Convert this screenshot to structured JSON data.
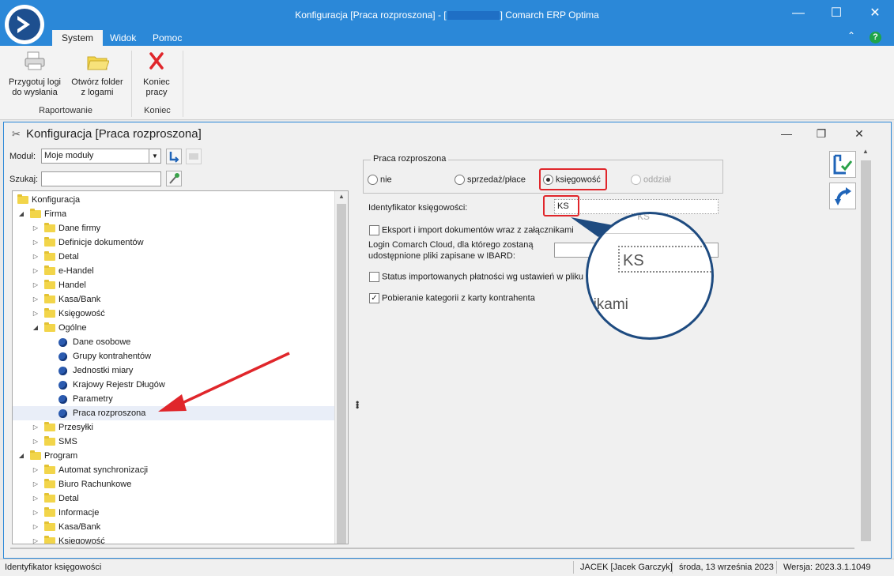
{
  "window": {
    "title_prefix": "Konfiguracja [Praca rozproszona] - [",
    "title_suffix": "] Comarch ERP Optima",
    "minimize": "—",
    "maximize": "☐",
    "close": "✕"
  },
  "menu": {
    "tabs": [
      "System",
      "Widok",
      "Pomoc"
    ],
    "active": "System",
    "collapse": "⌃",
    "help": "?"
  },
  "ribbon": {
    "buttons": [
      {
        "line1": "Przygotuj logi",
        "line2": "do wysłania",
        "icon": "printer-icon"
      },
      {
        "line1": "Otwórz folder",
        "line2": "z logami",
        "icon": "folder-icon"
      },
      {
        "line1": "Koniec",
        "line2": "pracy",
        "icon": "close-x-icon"
      }
    ],
    "groups": [
      "Raportowanie",
      "Koniec"
    ]
  },
  "inner_window": {
    "title": "Konfiguracja [Praca rozproszona]",
    "minimize": "—",
    "restore": "❐",
    "close": "✕"
  },
  "filter": {
    "module_label": "Moduł:",
    "module_value": "Moje moduły",
    "search_label": "Szukaj:",
    "search_value": ""
  },
  "tree": {
    "items": [
      {
        "label": "Konfiguracja",
        "level": 0,
        "type": "root",
        "expand": ""
      },
      {
        "label": "Firma",
        "level": 1,
        "type": "folder",
        "expand": "◢"
      },
      {
        "label": "Dane firmy",
        "level": 2,
        "type": "folder",
        "expand": "▷"
      },
      {
        "label": "Definicje dokumentów",
        "level": 2,
        "type": "folder",
        "expand": "▷"
      },
      {
        "label": "Detal",
        "level": 2,
        "type": "folder",
        "expand": "▷"
      },
      {
        "label": "e-Handel",
        "level": 2,
        "type": "folder",
        "expand": "▷"
      },
      {
        "label": "Handel",
        "level": 2,
        "type": "folder",
        "expand": "▷"
      },
      {
        "label": "Kasa/Bank",
        "level": 2,
        "type": "folder",
        "expand": "▷"
      },
      {
        "label": "Księgowość",
        "level": 2,
        "type": "folder",
        "expand": "▷"
      },
      {
        "label": "Ogólne",
        "level": 2,
        "type": "folder",
        "expand": "◢"
      },
      {
        "label": "Dane osobowe",
        "level": 3,
        "type": "leaf",
        "expand": ""
      },
      {
        "label": "Grupy kontrahentów",
        "level": 3,
        "type": "leaf",
        "expand": ""
      },
      {
        "label": "Jednostki miary",
        "level": 3,
        "type": "leaf",
        "expand": ""
      },
      {
        "label": "Krajowy Rejestr Długów",
        "level": 3,
        "type": "leaf",
        "expand": ""
      },
      {
        "label": "Parametry",
        "level": 3,
        "type": "leaf",
        "expand": ""
      },
      {
        "label": "Praca rozproszona",
        "level": 3,
        "type": "leaf",
        "expand": "",
        "selected": true
      },
      {
        "label": "Przesyłki",
        "level": 2,
        "type": "folder",
        "expand": "▷"
      },
      {
        "label": "SMS",
        "level": 2,
        "type": "folder",
        "expand": "▷"
      },
      {
        "label": "Program",
        "level": 1,
        "type": "folder",
        "expand": "◢"
      },
      {
        "label": "Automat synchronizacji",
        "level": 2,
        "type": "folder",
        "expand": "▷"
      },
      {
        "label": "Biuro Rachunkowe",
        "level": 2,
        "type": "folder",
        "expand": "▷"
      },
      {
        "label": "Detal",
        "level": 2,
        "type": "folder",
        "expand": "▷"
      },
      {
        "label": "Informacje",
        "level": 2,
        "type": "folder",
        "expand": "▷"
      },
      {
        "label": "Kasa/Bank",
        "level": 2,
        "type": "folder",
        "expand": "▷"
      },
      {
        "label": "Księgowość",
        "level": 2,
        "type": "folder",
        "expand": "▷"
      }
    ]
  },
  "panel": {
    "group_title": "Praca rozproszona",
    "radios": [
      {
        "label": "nie",
        "checked": false,
        "disabled": false
      },
      {
        "label": "sprzedaż/płace",
        "checked": false,
        "disabled": false
      },
      {
        "label": "księgowość",
        "checked": true,
        "disabled": false
      },
      {
        "label": "oddział",
        "checked": false,
        "disabled": true
      }
    ],
    "id_label": "Identyfikator księgowości:",
    "id_value": "KS",
    "export_label": "Eksport i import dokumentów wraz z załącznikami",
    "export_checked": false,
    "login_label_1": "Login Comarch Cloud, dla którego zostaną",
    "login_label_2": "udostępnione pliki zapisane w IBARD:",
    "login_value": "",
    "status_label": "Status importowanych płatności wg ustawień w pliku",
    "status_checked": false,
    "category_label": "Pobieranie kategorii z karty kontrahenta",
    "category_checked": true,
    "check_mark": "✓"
  },
  "magnifier": {
    "value": "KS",
    "fragment": "nikami",
    "top_fragment": "ks"
  },
  "statusbar": {
    "field": "Identyfikator księgowości",
    "user": "JACEK [Jacek Garczyk]",
    "date": "środa, 13 września 2023",
    "version": "Wersja: 2023.3.1.1049"
  },
  "colors": {
    "accent": "#2b88d8",
    "highlight": "#e0262b",
    "magnifier_ring": "#1e4b80"
  }
}
